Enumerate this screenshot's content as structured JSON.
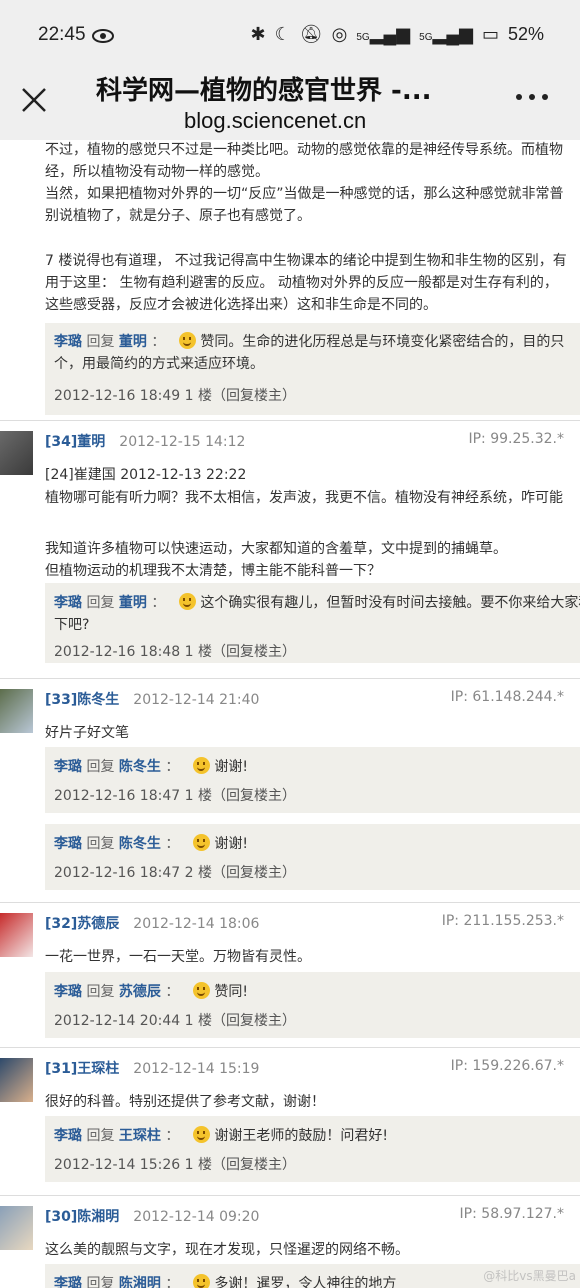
{
  "status": {
    "time": "22:45",
    "battery": "52%",
    "sig1": "5G",
    "sig2": "5G"
  },
  "header": {
    "title": "科学网—植物的感官世界 -...",
    "url": "blog.sciencenet.cn"
  },
  "top_text": [
    "不过，植物的感觉只不过是一种类比吧。动物的感觉依靠的是神经传导系统。而植物",
    "经，所以植物没有动物一样的感觉。",
    "当然，如果把植物对外界的一切“反应”当做是一种感觉的话，那么这种感觉就非常普",
    "别说植物了，就是分子、原子也有感觉了。",
    "7 楼说得也有道理， 不过我记得高中生物课本的绪论中提到生物和非生物的区别，有",
    "用于这里： 生物有趋利避害的反应。 动植物对外界的反应一般都是对生存有利的，",
    "这些感受器，反应才会被进化选择出来）这和非生命是不同的。"
  ],
  "top_reply": {
    "author": "李璐",
    "verb": "回复",
    "target": "董明",
    "colon": "：",
    "text1": "赞同。生命的进化历程总是与环境变化紧密结合的，目的只",
    "text2": "个，用最简约的方式来适应环境。",
    "date": "2012-12-16 18:49",
    "floor": "1 楼",
    "reply_link": "（回复楼主）"
  },
  "comments": [
    {
      "num": "[34]",
      "name": "董明",
      "time": "2012-12-15 14:12",
      "ip": "IP: 99.25.32.*",
      "lines": [
        "[24]崔建国   2012-12-13 22:22",
        "植物哪可能有听力啊？我不太相信，发声波，我更不信。植物没有神经系统，咋可能",
        "",
        "我知道许多植物可以快速运动，大家都知道的含羞草，文中提到的捕蝇草。",
        "但植物运动的机理我不太清楚，博主能不能科普一下？"
      ],
      "replies": [
        {
          "author": "李璐",
          "verb": "回复",
          "target": "董明",
          "colon": "：",
          "text": "这个确实很有趣儿，但暂时没有时间去接触。要不你来给大家科",
          "text2": "下吧?",
          "date": "2012-12-16 18:48",
          "floor": "1 楼",
          "reply_link": "（回复楼主）"
        }
      ]
    },
    {
      "num": "[33]",
      "name": "陈冬生",
      "time": "2012-12-14 21:40",
      "ip": "IP: 61.148.244.*",
      "lines": [
        "好片子好文笔"
      ],
      "replies": [
        {
          "author": "李璐",
          "verb": "回复",
          "target": "陈冬生",
          "colon": "：",
          "text": "谢谢!",
          "date": "2012-12-16 18:47",
          "floor": "1 楼",
          "reply_link": "（回复楼主）"
        },
        {
          "author": "李璐",
          "verb": "回复",
          "target": "陈冬生",
          "colon": "：",
          "text": "谢谢!",
          "date": "2012-12-16 18:47",
          "floor": "2 楼",
          "reply_link": "（回复楼主）"
        }
      ]
    },
    {
      "num": "[32]",
      "name": "苏德辰",
      "time": "2012-12-14 18:06",
      "ip": "IP: 211.155.253.*",
      "lines": [
        "一花一世界，一石一天堂。万物皆有灵性。"
      ],
      "replies": [
        {
          "author": "李璐",
          "verb": "回复",
          "target": "苏德辰",
          "colon": "：",
          "text": "赞同!",
          "date": "2012-12-14 20:44",
          "floor": "1 楼",
          "reply_link": "（回复楼主）"
        }
      ]
    },
    {
      "num": "[31]",
      "name": "王琛柱",
      "time": "2012-12-14 15:19",
      "ip": "IP: 159.226.67.*",
      "lines": [
        "很好的科普。特别还提供了参考文献，谢谢！"
      ],
      "replies": [
        {
          "author": "李璐",
          "verb": "回复",
          "target": "王琛柱",
          "colon": "：",
          "text": "谢谢王老师的鼓励！问君好!",
          "date": "2012-12-14 15:26",
          "floor": "1 楼",
          "reply_link": "（回复楼主）"
        }
      ]
    },
    {
      "num": "[30]",
      "name": "陈湘明",
      "time": "2012-12-14 09:20",
      "ip": "IP: 58.97.127.*",
      "lines": [
        "这么美的靓照与文字，现在才发现，只怪暹逻的网络不畅。"
      ],
      "replies": [
        {
          "author": "李璐",
          "verb": "回复",
          "target": "陈湘明",
          "colon": "：",
          "text": "多谢！暹罗，令人神往的地方",
          "date": "",
          "floor": "",
          "reply_link": ""
        }
      ]
    }
  ],
  "watermark": "@科比vs黑曼巴a"
}
